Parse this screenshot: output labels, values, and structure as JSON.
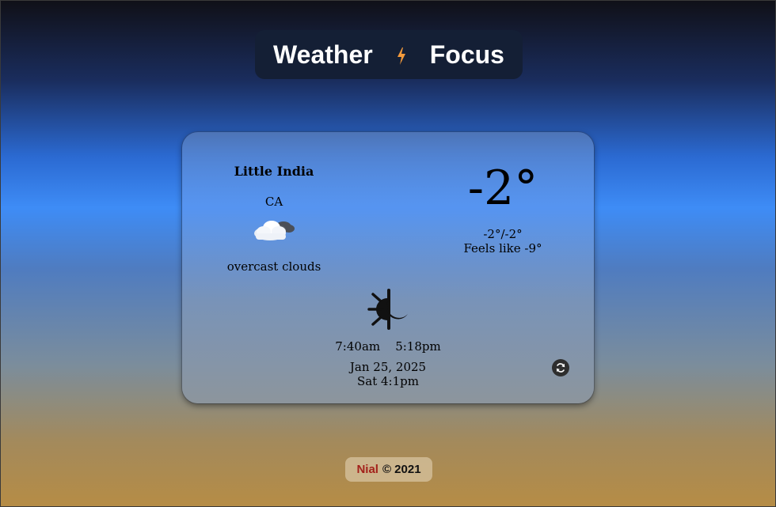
{
  "header": {
    "title_left": "Weather",
    "title_right": "Focus",
    "accent_color": "#f39a3c"
  },
  "weather": {
    "city": "Little India",
    "country": "CA",
    "condition_icon": "cloud-icon",
    "description": "overcast clouds",
    "temperature": "-2°",
    "min_max": "-2°/-2°",
    "feels_like": "Feels like -9°",
    "daynight_icon": "sun-moon-icon",
    "sunrise": "7:40am",
    "sunset": "5:18pm",
    "date": "Jan 25, 2025",
    "day_time": "Sat 4:1pm",
    "refresh_icon": "refresh-icon"
  },
  "footer": {
    "author": "Nial",
    "copyright": "© 2021",
    "author_color": "#a3221b"
  }
}
